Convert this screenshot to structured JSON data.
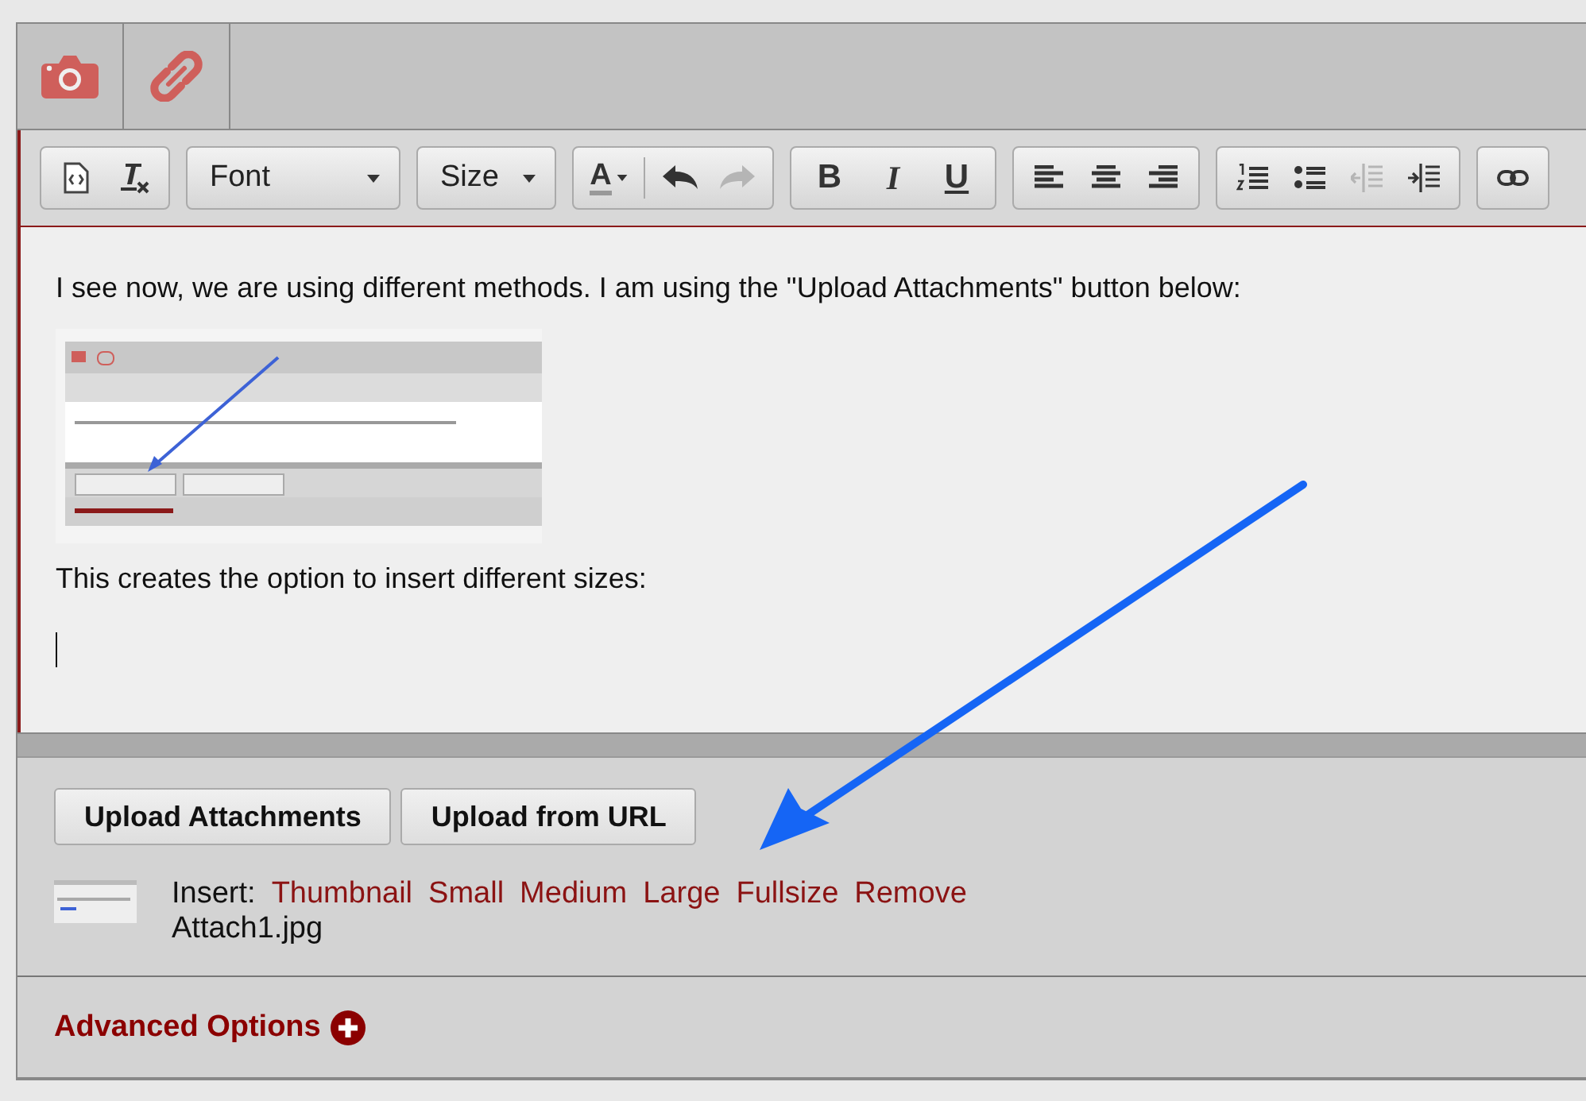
{
  "tabs": [
    {
      "kind": "camera"
    },
    {
      "kind": "link"
    }
  ],
  "toolbar": {
    "font_dropdown": {
      "label": "Font"
    },
    "size_dropdown": {
      "label": "Size"
    },
    "text_color": {
      "label": "A"
    },
    "undo": {
      "disabled": false
    },
    "redo": {
      "disabled": true
    },
    "format_buttons": [
      {
        "label": "B",
        "kind": "bold"
      },
      {
        "label": "I",
        "kind": "italic"
      },
      {
        "label": "U",
        "kind": "underline"
      }
    ],
    "outdent": {
      "disabled": true
    },
    "indent": {
      "disabled": false
    }
  },
  "editor": {
    "paragraphs": [
      {
        "kind": "text",
        "text": "I see now, we are using different methods. I am using the \"Upload Attachments\" button below:"
      },
      {
        "kind": "image"
      },
      {
        "kind": "text",
        "text": "This creates the option to insert different sizes:"
      },
      {
        "kind": "cursor"
      }
    ]
  },
  "attachments": {
    "buttons": [
      "Upload Attachments",
      "Upload from URL"
    ],
    "file": {
      "insert_label": "Insert:",
      "links": [
        "Thumbnail",
        "Small",
        "Medium",
        "Large",
        "Fullsize",
        "Remove"
      ],
      "filename": "Attach1.jpg"
    }
  },
  "advanced_options": {
    "label": "Advanced Options",
    "expanded": false
  }
}
